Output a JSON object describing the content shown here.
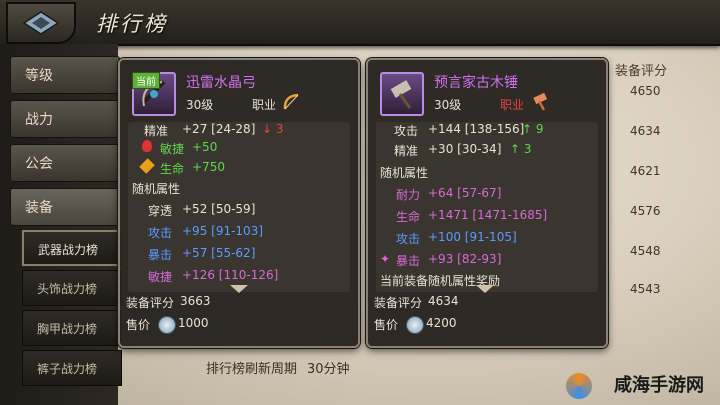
{
  "header": {
    "title": "排行榜"
  },
  "sidebar": {
    "categories": [
      "等级",
      "战力",
      "公会",
      "装备"
    ],
    "subs": [
      "武器战力榜",
      "头饰战力榜",
      "胸甲战力榜",
      "裤子战力榜"
    ]
  },
  "table": {
    "score_header": "装备评分",
    "scores": [
      "4650",
      "4634",
      "4621",
      "4576",
      "4548",
      "4543"
    ]
  },
  "left_item": {
    "tag": "当前",
    "name": "迅雷水晶弓",
    "level": "30级",
    "job_label": "职业",
    "stats": [
      {
        "label": "精准",
        "value": "+27 [24-28]",
        "diff": "↓ 3"
      },
      {
        "label": "敏捷",
        "value": "+50"
      },
      {
        "label": "生命",
        "value": "+750"
      }
    ],
    "random_title": "随机属性",
    "random": [
      {
        "label": "穿透",
        "value": "+52 [50-59]"
      },
      {
        "label": "攻击",
        "value": "+95 [91-103]"
      },
      {
        "label": "暴击",
        "value": "+57 [55-62]"
      },
      {
        "label": "敏捷",
        "value": "+126 [110-126]"
      }
    ],
    "score_label": "装备评分",
    "score": "3663",
    "price_label": "售价",
    "price": "1000"
  },
  "right_item": {
    "name": "预言家古木锤",
    "level": "30级",
    "job_label": "职业",
    "stats": [
      {
        "label": "攻击",
        "value": "+144 [138-156]",
        "diff": "↑ 9"
      },
      {
        "label": "精准",
        "value": "+30 [30-34]",
        "diff": "↑ 3"
      }
    ],
    "random_title": "随机属性",
    "random": [
      {
        "label": "耐力",
        "value": "+64 [57-67]"
      },
      {
        "label": "生命",
        "value": "+1471 [1471-1685]"
      },
      {
        "label": "攻击",
        "value": "+100 [91-105]"
      },
      {
        "label": "暴击",
        "value": "+93 [82-93]"
      }
    ],
    "bonus_title": "当前装备随机属性奖励",
    "score_label": "装备评分",
    "score": "4634",
    "price_label": "售价",
    "price": "4200"
  },
  "footer": {
    "refresh_label": "排行榜刷新周期",
    "refresh_value": "30分钟"
  },
  "watermark": "咸海手游网",
  "colors": {
    "accent_purple": "#d070f0",
    "green": "#5fd64f",
    "red": "#e04545",
    "blue": "#5a9bff"
  }
}
